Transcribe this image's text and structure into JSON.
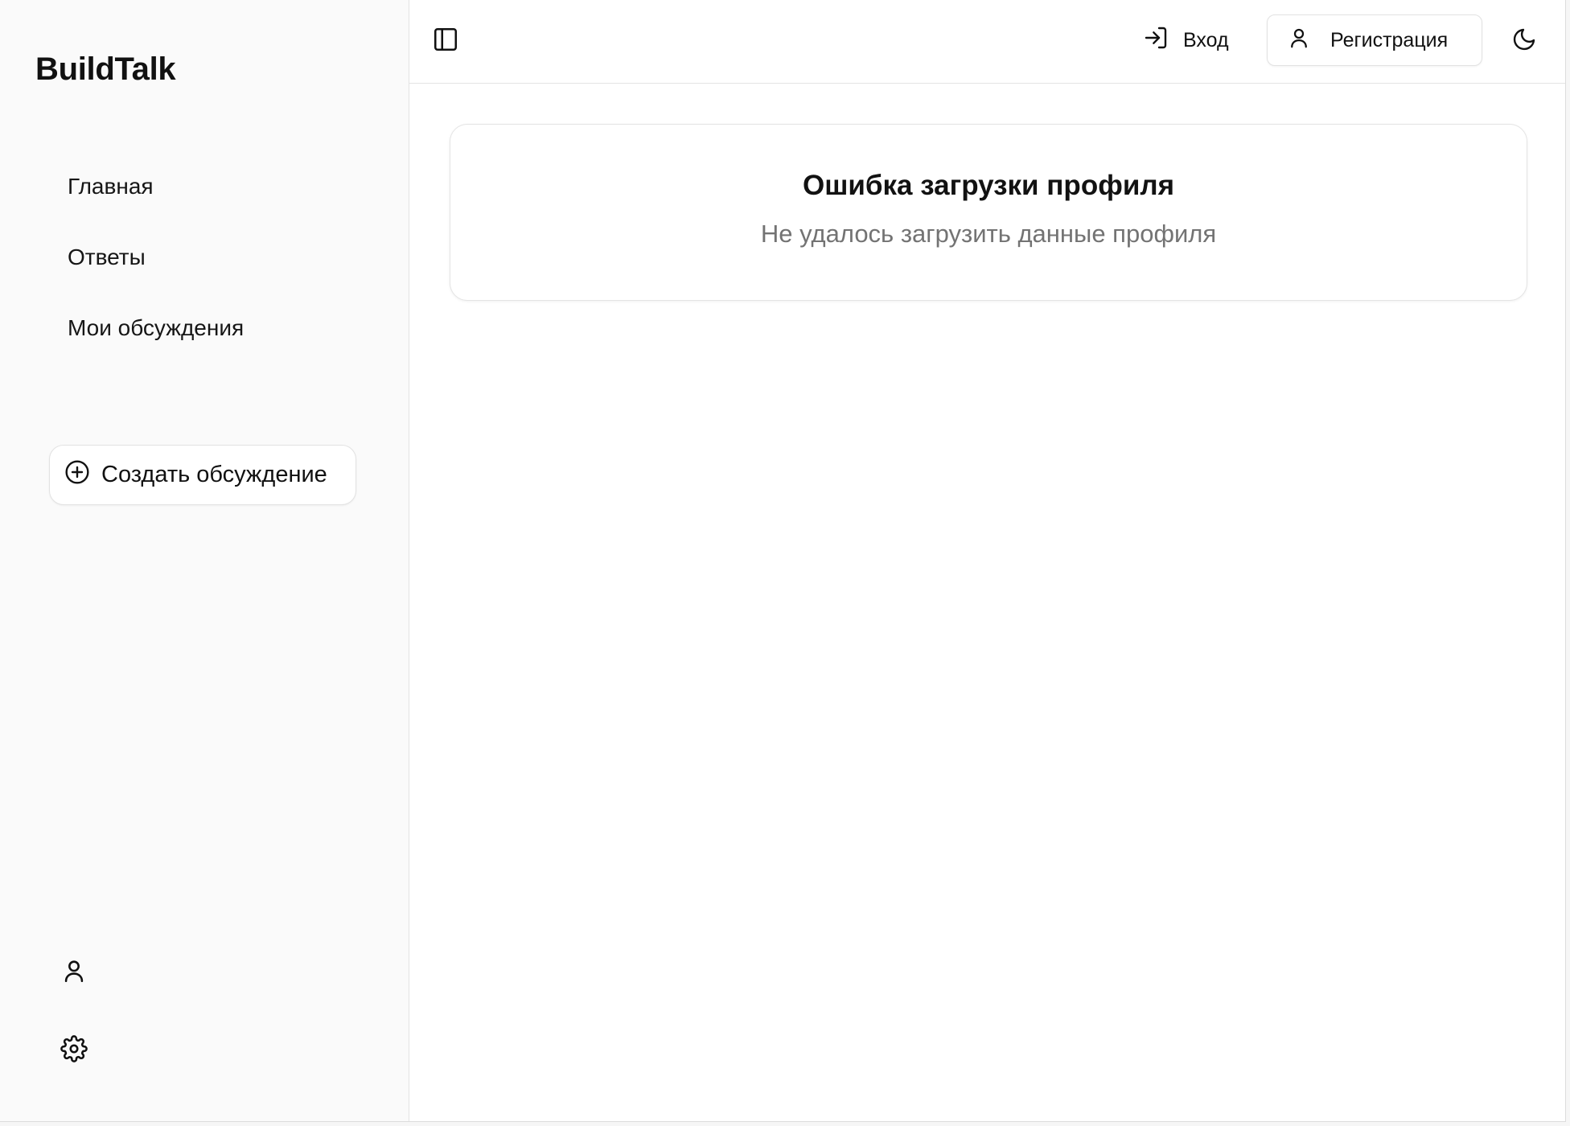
{
  "app": {
    "brand": "BuildTalk"
  },
  "sidebar": {
    "items": [
      {
        "label": "Главная"
      },
      {
        "label": "Ответы"
      },
      {
        "label": "Мои обсуждения"
      }
    ],
    "create_button": {
      "label": "Создать обсуждение",
      "icon": "plus-circle-icon"
    },
    "bottom_icons": [
      "user-icon",
      "gear-icon"
    ]
  },
  "header": {
    "toggle_icon": "sidebar-toggle-icon",
    "login": {
      "label": "Вход",
      "icon": "login-arrow-icon"
    },
    "register": {
      "label": "Регистрация",
      "icon": "user-icon"
    },
    "theme_icon": "moon-icon"
  },
  "main": {
    "error": {
      "title": "Ошибка загрузки профиля",
      "message": "Не удалось загрузить данные профиля"
    }
  },
  "colors": {
    "sidebar_bg": "#fafafa",
    "main_bg": "#ffffff",
    "border": "#e3e3e3",
    "text": "#111111",
    "muted_text": "#737373"
  }
}
